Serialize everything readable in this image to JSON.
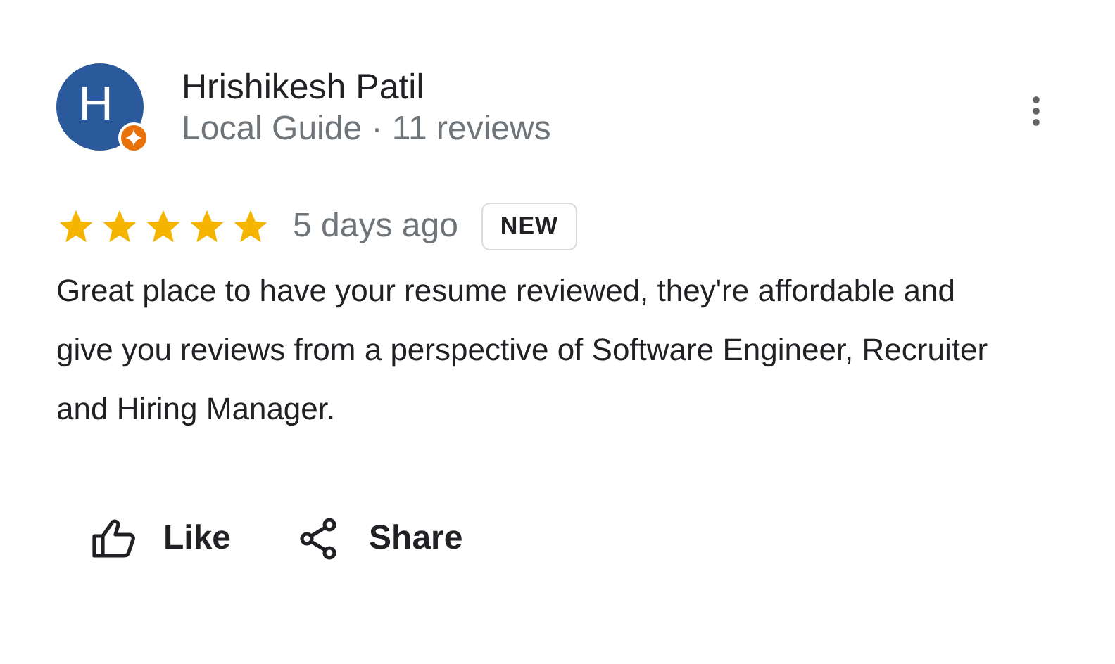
{
  "reviewer": {
    "initial": "H",
    "name": "Hrishikesh Patil",
    "subtitle": "Local Guide · 11 reviews",
    "local_guide": true
  },
  "review": {
    "stars": 5,
    "time": "5 days ago",
    "badge": "NEW",
    "text": "Great place to have your resume reviewed, they're affordable and give you reviews from a perspective of Software Engineer, Recruiter and Hiring Manager."
  },
  "actions": [
    {
      "kind": "like",
      "label": "Like"
    },
    {
      "kind": "share",
      "label": "Share"
    }
  ]
}
